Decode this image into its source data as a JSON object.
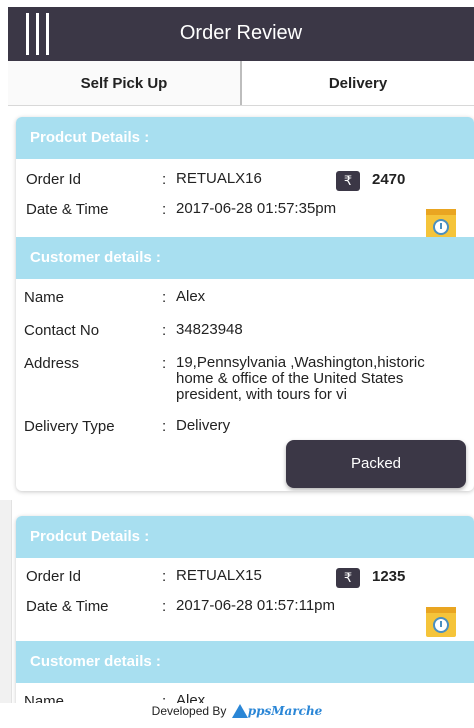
{
  "header": {
    "title": "Order Review",
    "menu_icon": "hamburger-menu-icon"
  },
  "tabs": [
    {
      "label": "Self Pick Up"
    },
    {
      "label": "Delivery"
    }
  ],
  "labels": {
    "product_details": "Prodcut Details :",
    "customer_details": "Customer details :",
    "order_id": "Order Id",
    "date_time": "Date & Time",
    "name": "Name",
    "contact_no": "Contact No",
    "address": "Address",
    "delivery_type": "Delivery Type",
    "colon": ":"
  },
  "orders": [
    {
      "order_id": "RETUALX16",
      "currency": "₹",
      "amount": "2470",
      "date_time": "2017-06-28 01:57:35pm",
      "name": "Alex",
      "contact_no": "34823948",
      "address": "19,Pennsylvania ,Washington,historic home & office of the United States president, with tours for vi",
      "delivery_type": "Delivery",
      "action_label": "Packed"
    },
    {
      "order_id": "RETUALX15",
      "currency": "₹",
      "amount": "1235",
      "date_time": "2017-06-28 01:57:11pm",
      "name": "Alex"
    }
  ],
  "footer": {
    "developed_by": "Developed By",
    "brand": "ppsMarche"
  },
  "colors": {
    "header_bg": "#3b3746",
    "section_band": "#a8dff0",
    "button_bg": "#3b3746",
    "clock_icon": "#f5c43a"
  }
}
